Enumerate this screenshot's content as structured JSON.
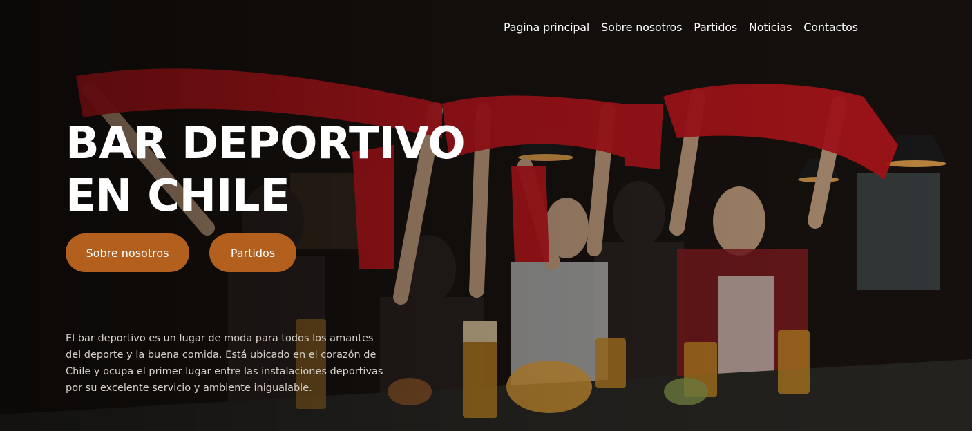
{
  "nav": {
    "items": [
      "Pagina principal",
      "Sobre nosotros",
      "Partidos",
      "Noticias",
      "Contactos"
    ]
  },
  "hero": {
    "title_line1": "BAR DEPORTIVO",
    "title_line2": "EN CHILE",
    "button_about": "Sobre nosotros",
    "button_matches": "Partidos",
    "description": "El bar deportivo es un lugar de moda para todos los amantes del deporte y la buena comida. Está ubicado en el corazón de Chile y ocupa el primer lugar entre las instalaciones deportivas por su excelente servicio y ambiente inigualable.",
    "background_image": "fans-cheering-with-red-scarves-at-bar"
  },
  "colors": {
    "accent": "#b3601f",
    "scarf": "#c8181f"
  }
}
